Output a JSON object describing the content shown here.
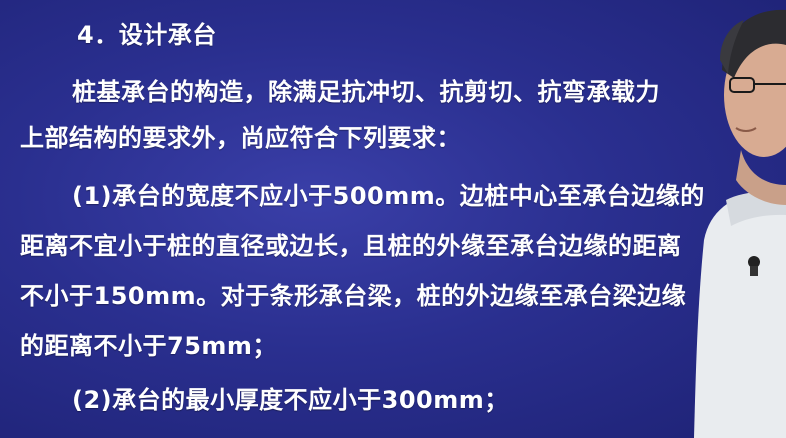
{
  "slide": {
    "heading": "4．设计承台",
    "lines": [
      "桩基承台的构造，除满足抗冲切、抗剪切、抗弯承载力",
      "上部结构的要求外，尚应符合下列要求：",
      "(1)承台的宽度不应小于500mm。边桩中心至承台边缘的",
      "距离不宜小于桩的直径或边长，且桩的外缘至承台边缘的距离",
      "不小于150mm。对于条形承台梁，桩的外边缘至承台梁边缘",
      "的距离不小于75mm；",
      "(2)承台的最小厚度不应小于300mm；"
    ]
  },
  "colors": {
    "background": "#2a2f8f",
    "text": "#ffffff"
  },
  "presenter": {
    "icon": "presenter-figure"
  }
}
